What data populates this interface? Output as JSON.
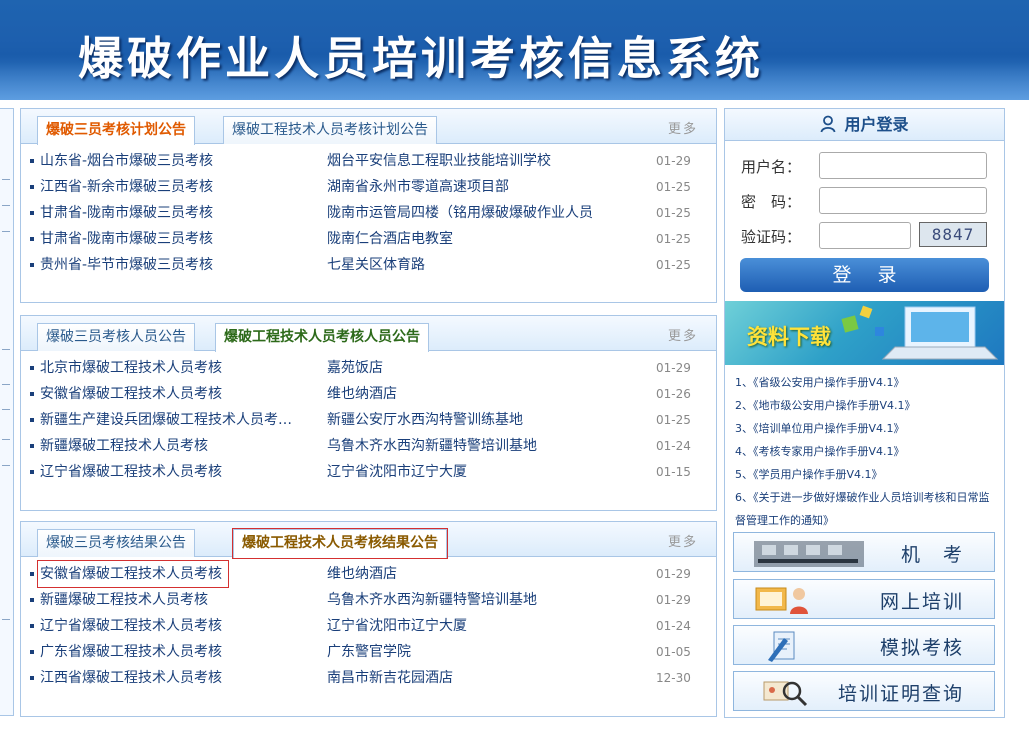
{
  "header": {
    "title": "爆破作业人员培训考核信息系统"
  },
  "panels": [
    {
      "tabs": [
        "爆破三员考核计划公告",
        "爆破工程技术人员考核计划公告"
      ],
      "more": "更多",
      "rows": [
        {
          "title": "山东省-烟台市爆破三员考核",
          "place": "烟台平安信息工程职业技能培训学校",
          "date": "01-29"
        },
        {
          "title": "江西省-新余市爆破三员考核",
          "place": "湖南省永州市零道高速项目部",
          "date": "01-25"
        },
        {
          "title": "甘肃省-陇南市爆破三员考核",
          "place": "陇南市运管局四楼（铭用爆破爆破作业人员",
          "date": "01-25"
        },
        {
          "title": "甘肃省-陇南市爆破三员考核",
          "place": "陇南仁合酒店电教室",
          "date": "01-25"
        },
        {
          "title": "贵州省-毕节市爆破三员考核",
          "place": "七星关区体育路",
          "date": "01-25"
        }
      ]
    },
    {
      "tabs": [
        "爆破三员考核人员公告",
        "爆破工程技术人员考核人员公告"
      ],
      "more": "更多",
      "rows": [
        {
          "title": "北京市爆破工程技术人员考核",
          "place": "嘉苑饭店",
          "date": "01-29"
        },
        {
          "title": "安徽省爆破工程技术人员考核",
          "place": "维也纳酒店",
          "date": "01-26"
        },
        {
          "title": "新疆生产建设兵团爆破工程技术人员考…",
          "place": "新疆公安厅水西沟特警训练基地",
          "date": "01-25"
        },
        {
          "title": "新疆爆破工程技术人员考核",
          "place": "乌鲁木齐水西沟新疆特警培训基地",
          "date": "01-24"
        },
        {
          "title": "辽宁省爆破工程技术人员考核",
          "place": "辽宁省沈阳市辽宁大厦",
          "date": "01-15"
        }
      ]
    },
    {
      "tabs": [
        "爆破三员考核结果公告",
        "爆破工程技术人员考核结果公告"
      ],
      "more": "更多",
      "rows": [
        {
          "title": "安徽省爆破工程技术人员考核",
          "place": "维也纳酒店",
          "date": "01-29"
        },
        {
          "title": "新疆爆破工程技术人员考核",
          "place": "乌鲁木齐水西沟新疆特警培训基地",
          "date": "01-29"
        },
        {
          "title": "辽宁省爆破工程技术人员考核",
          "place": "辽宁省沈阳市辽宁大厦",
          "date": "01-24"
        },
        {
          "title": "广东省爆破工程技术人员考核",
          "place": "广东警官学院",
          "date": "01-05"
        },
        {
          "title": "江西省爆破工程技术人员考核",
          "place": "南昌市新吉花园酒店",
          "date": "12-30"
        }
      ]
    }
  ],
  "login": {
    "header": "用户登录",
    "username_label": "用户名：",
    "password_label": "密　码：",
    "captcha_label": "验证码：",
    "captcha_value": "8847",
    "submit_label": "登录"
  },
  "downloads": {
    "banner": "资料下载",
    "items": [
      "1、《省级公安用户操作手册V4.1》",
      "2、《地市级公安用户操作手册V4.1》",
      "3、《培训单位用户操作手册V4.1》",
      "4、《考核专家用户操作手册V4.1》",
      "5、《学员用户操作手册V4.1》",
      "6、《关于进一步做好爆破作业人员培训考核和日常监督管理工作的通知》"
    ]
  },
  "shortcuts": [
    {
      "label": "机　考",
      "icon": "computer-lab-icon"
    },
    {
      "label": "网上培训",
      "icon": "online-training-icon"
    },
    {
      "label": "模拟考核",
      "icon": "pen-document-icon"
    },
    {
      "label": "培训证明查询",
      "icon": "magnifier-certificate-icon"
    }
  ],
  "colors": {
    "banner_blue": "#1d5fae",
    "link_blue": "#1a3f7a",
    "tab_orange": "#e05a00",
    "tab_green": "#2d6a1a",
    "tab_olive": "#8a5a00",
    "highlight_red": "#d43030"
  }
}
